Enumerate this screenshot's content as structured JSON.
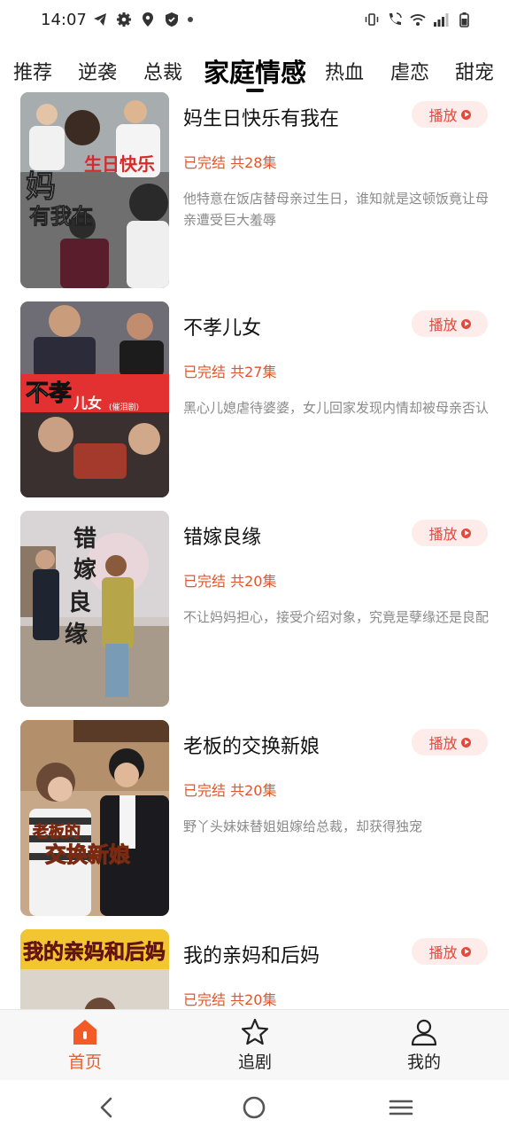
{
  "status_bar": {
    "time": "14:07",
    "left_icons": [
      "telegram-icon",
      "gear-icon",
      "location-icon",
      "shield-icon"
    ],
    "right_icons": [
      "vibrate-icon",
      "wifi-call-icon",
      "wifi-icon",
      "signal-icon",
      "battery-icon"
    ]
  },
  "tabs": [
    {
      "label": "推荐",
      "active": false
    },
    {
      "label": "逆袭",
      "active": false
    },
    {
      "label": "总裁",
      "active": false
    },
    {
      "label": "家庭情感",
      "active": true
    },
    {
      "label": "热血",
      "active": false
    },
    {
      "label": "虐恋",
      "active": false
    },
    {
      "label": "甜宠",
      "active": false
    }
  ],
  "play_label": "播放",
  "dramas": [
    {
      "title": "妈生日快乐有我在",
      "status": "已完结 共28集",
      "description": "他特意在饭店替母亲过生日，谁知就是这顿饭竟让母亲遭受巨大羞辱",
      "cover_text": "生日快乐 妈 有我在"
    },
    {
      "title": "不孝儿女",
      "status": "已完结 共27集",
      "description": "黑心儿媳虐待婆婆，女儿回家发现内情却被母亲否认",
      "cover_text": "不孝儿女 (催泪剧)"
    },
    {
      "title": "错嫁良缘",
      "status": "已完结 共20集",
      "description": "不让妈妈担心，接受介绍对象，究竟是孽缘还是良配",
      "cover_text": "错嫁良缘"
    },
    {
      "title": "老板的交换新娘",
      "status": "已完结 共20集",
      "description": "野丫头妹妹替姐姐嫁给总裁，却获得独宠",
      "cover_text": "老板的交换新娘"
    },
    {
      "title": "我的亲妈和后妈",
      "status": "已完结 共20集",
      "description": "",
      "cover_text": "我的亲妈和后妈"
    }
  ],
  "bottom_nav": [
    {
      "label": "首页",
      "icon": "home-icon",
      "active": true
    },
    {
      "label": "追剧",
      "icon": "star-icon",
      "active": false
    },
    {
      "label": "我的",
      "icon": "user-icon",
      "active": false
    }
  ],
  "colors": {
    "accent": "#f25a27",
    "status_text": "#e2552d",
    "play_bg": "#fdecea",
    "desc_text": "#8a8a8a"
  }
}
